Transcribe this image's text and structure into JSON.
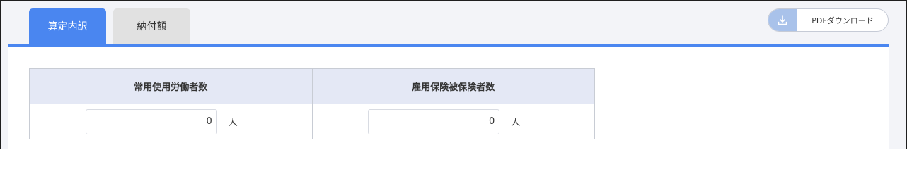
{
  "tabs": [
    {
      "label": "算定内訳",
      "active": true
    },
    {
      "label": "納付額",
      "active": false
    }
  ],
  "pdf_button": {
    "label": "PDFダウンロード",
    "icon": "download-icon"
  },
  "table": {
    "columns": [
      {
        "header": "常用使用労働者数",
        "value": "0",
        "unit": "人"
      },
      {
        "header": "雇用保険被保険者数",
        "value": "0",
        "unit": "人"
      }
    ]
  },
  "colors": {
    "accent": "#4a86f0",
    "header_bg": "#e4e8f5",
    "icon_bg": "#a9c2ea"
  }
}
